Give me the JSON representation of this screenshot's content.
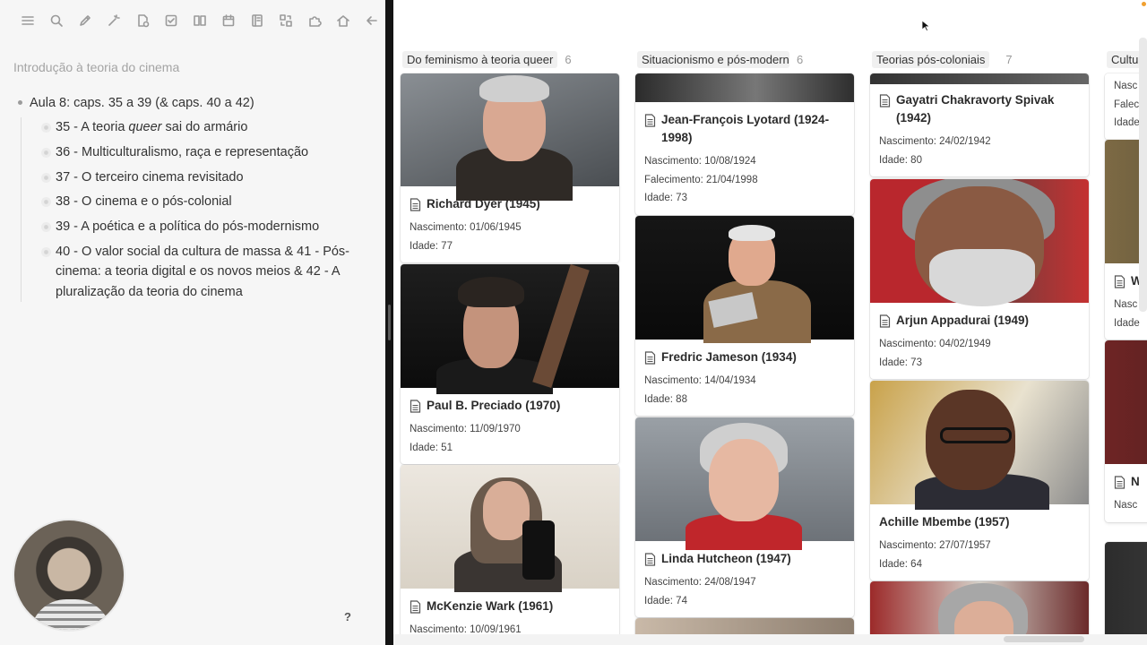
{
  "sidebar": {
    "toolbar_icons": [
      "list-icon",
      "search-icon",
      "edit-icon",
      "magic-icon",
      "file-clock-icon",
      "checkbox-icon",
      "book-icon",
      "calendar-icon",
      "notebook-icon",
      "swap-icon",
      "puzzle-icon",
      "home-icon",
      "arrow-left-icon"
    ],
    "note_title": "Introdução à teoria do cinema",
    "outline": {
      "root": "Aula 8: caps. 35 a 39 (& caps. 40 a 42)",
      "items": [
        {
          "prefix": "35 - A teoria ",
          "em": "queer",
          "suffix": " sai do armário"
        },
        {
          "prefix": "36 - Multiculturalismo, raça e representação"
        },
        {
          "prefix": "37 - O terceiro cinema revisitado"
        },
        {
          "prefix": "38 - O cinema e o pós-colonial"
        },
        {
          "prefix": "39 - A poética e a política do pós-modernismo"
        },
        {
          "prefix": "40 - O valor social da cultura de massa & 41 - Pós-cinema: a teoria digital e os novos meios & 42 - A pluralização da teoria do cinema"
        }
      ]
    },
    "help": "?"
  },
  "board": {
    "columns": [
      {
        "title": "Do feminismo à teoria queer",
        "count": "6",
        "cards": [
          {
            "name": "Richard Dyer (1945)",
            "props": [
              "Nascimento: 01/06/1945",
              "Idade: 77"
            ]
          },
          {
            "name": "Paul B. Preciado (1970)",
            "props": [
              "Nascimento: 11/09/1970",
              "Idade: 51"
            ]
          },
          {
            "name": "McKenzie Wark (1961)",
            "props": [
              "Nascimento: 10/09/1961"
            ]
          }
        ]
      },
      {
        "title": "Situacionismo e pós-modernismo",
        "count": "6",
        "cards": [
          {
            "name": "Jean-François Lyotard (1924-1998)",
            "props": [
              "Nascimento: 10/08/1924",
              "Falecimento: 21/04/1998",
              "Idade: 73"
            ]
          },
          {
            "name": "Fredric Jameson (1934)",
            "props": [
              "Nascimento: 14/04/1934",
              "Idade: 88"
            ]
          },
          {
            "name": "Linda Hutcheon (1947)",
            "props": [
              "Nascimento: 24/08/1947",
              "Idade: 74"
            ]
          }
        ]
      },
      {
        "title": "Teorias pós-coloniais",
        "count": "7",
        "cards": [
          {
            "name": "Gayatri Chakravorty Spivak (1942)",
            "props": [
              "Nascimento: 24/02/1942",
              "Idade: 80"
            ]
          },
          {
            "name": "Arjun Appadurai (1949)",
            "props": [
              "Nascimento: 04/02/1949",
              "Idade: 73"
            ]
          },
          {
            "name": "Achille Mbembe (1957)",
            "props": [
              "Nascimento: 27/07/1957",
              "Idade: 64"
            ]
          }
        ]
      },
      {
        "title": "Cultura",
        "count": "",
        "cards": [
          {
            "name": "",
            "props": [
              "Nasc",
              "Falec",
              "Idade"
            ]
          },
          {
            "name": "W",
            "props": [
              "Nasc",
              "Idade"
            ]
          },
          {
            "name": "N",
            "props": [
              "Nasc"
            ]
          }
        ]
      }
    ]
  },
  "colors": {
    "sidebar_bg": "#f6f6f6",
    "divider": "#141414",
    "card_shadow": "#e6e6e6",
    "muted_text": "#a4a4a4"
  }
}
